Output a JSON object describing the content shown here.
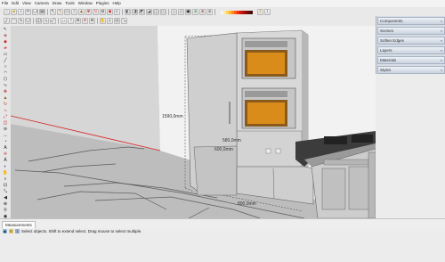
{
  "menu": [
    "File",
    "Edit",
    "View",
    "Camera",
    "Draw",
    "Tools",
    "Window",
    "Plugins",
    "Help"
  ],
  "trays": [
    "Components",
    "Scenes",
    "Soften Edges",
    "Layers",
    "Materials",
    "Styles"
  ],
  "dimensions": {
    "height": "1590,0mm",
    "side_a": "580,0mm",
    "side_b": "600,0mm",
    "width": "800,0mm"
  },
  "measurements_tab": "Measurements",
  "status_text": "Select objects. Shift to extend select. Drag mouse to select multiple.",
  "icons": {
    "select": "arrow-cursor-icon",
    "eraser": "eraser-icon",
    "pencil": "pencil-icon",
    "info": "info-icon"
  },
  "colors": {
    "background": "#ffffff",
    "cabinet": "#c9c9c9",
    "counter_top": "#3c3c3c",
    "oven_glow": "#d98c1a",
    "axis_red": "#d62020"
  }
}
